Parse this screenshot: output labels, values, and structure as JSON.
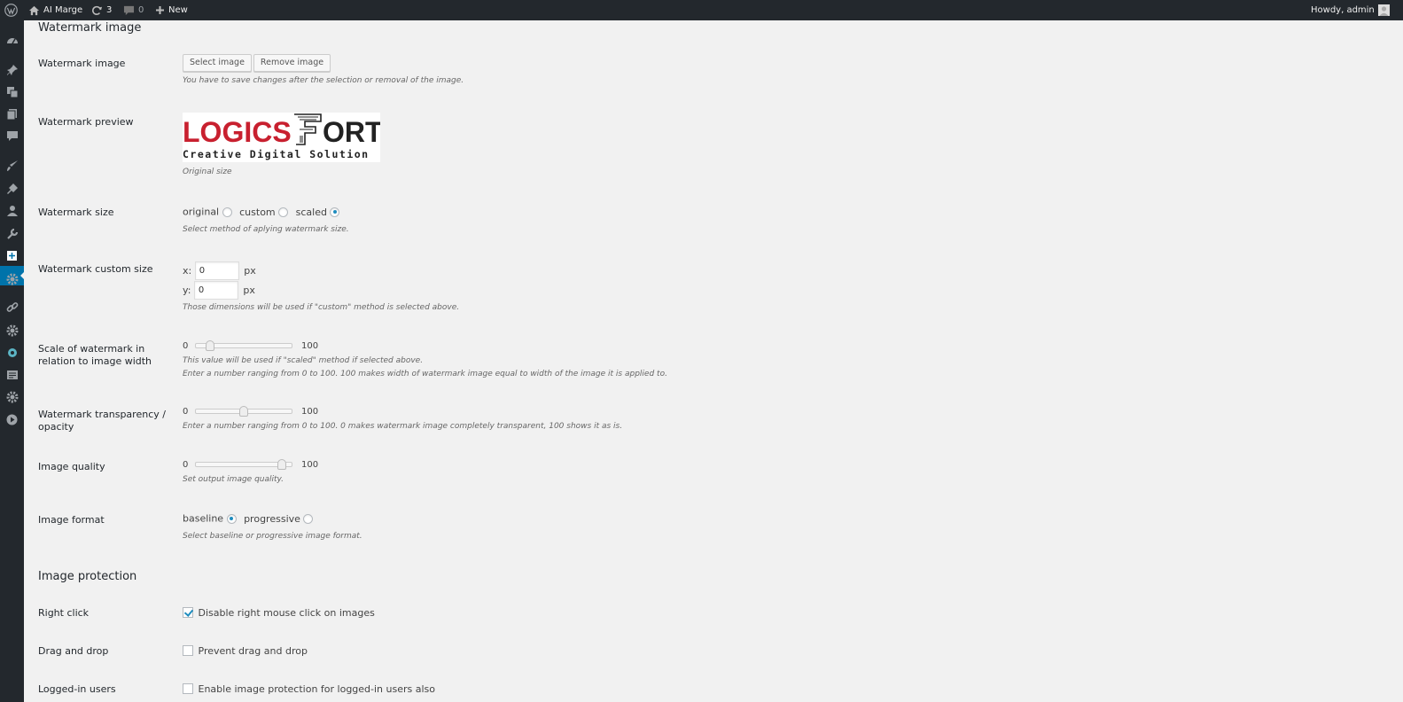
{
  "admin_bar": {
    "site_name": "AI Marge",
    "updates_count": "3",
    "comments_count": "0",
    "new_label": "New",
    "greeting": "Howdy, admin"
  },
  "sidebar": {
    "icons": [
      "dashboard-icon",
      "pin-icon",
      "media-icon",
      "pages-icon",
      "comments-icon",
      "appearance-icon",
      "plugins-icon",
      "users-icon",
      "tools-icon",
      "settings-active-icon",
      "gear-icon",
      "link-icon",
      "gear-icon",
      "circle-icon",
      "forms-icon",
      "gear-icon",
      "play-icon"
    ],
    "active_index": 9
  },
  "watermark_section": {
    "title": "Watermark image",
    "image": {
      "label": "Watermark image",
      "select_button": "Select image",
      "remove_button": "Remove image",
      "description": "You have to save changes after the selection or removal of the image."
    },
    "preview": {
      "label": "Watermark preview",
      "logo_main_left": "LOGICS",
      "logo_main_right": "ORT",
      "logo_tagline": "Creative Digital Solution",
      "description": "Original size"
    },
    "size": {
      "label": "Watermark size",
      "options": [
        "original",
        "custom",
        "scaled"
      ],
      "selected": "scaled",
      "description": "Select method of aplying watermark size."
    },
    "custom_size": {
      "label": "Watermark custom size",
      "x_label": "x:",
      "x_value": "0",
      "y_label": "y:",
      "y_value": "0",
      "unit": "px",
      "description": "Those dimensions will be used if \"custom\" method is selected above."
    },
    "scale": {
      "label": "Scale of watermark in relation to image width",
      "min": "0",
      "max": "100",
      "value": 15,
      "description_1": "This value will be used if \"scaled\" method if selected above.",
      "description_2": "Enter a number ranging from 0 to 100. 100 makes width of watermark image equal to width of the image it is applied to."
    },
    "opacity": {
      "label": "Watermark transparency / opacity",
      "min": "0",
      "max": "100",
      "value": 50,
      "description": "Enter a number ranging from 0 to 100. 0 makes watermark image completely transparent, 100 shows it as is."
    },
    "quality": {
      "label": "Image quality",
      "min": "0",
      "max": "100",
      "value": 90,
      "description": "Set output image quality."
    },
    "format": {
      "label": "Image format",
      "options": [
        "baseline",
        "progressive"
      ],
      "selected": "baseline",
      "description": "Select baseline or progressive image format."
    }
  },
  "protection_section": {
    "title": "Image protection",
    "right_click": {
      "label": "Right click",
      "checkbox_label": "Disable right mouse click on images",
      "checked": true
    },
    "drag_drop": {
      "label": "Drag and drop",
      "checkbox_label": "Prevent drag and drop",
      "checked": false
    },
    "logged_in": {
      "label": "Logged-in users",
      "checkbox_label": "Enable image protection for logged-in users also",
      "checked": false
    }
  },
  "colors": {
    "admin_bar_bg": "#23282d",
    "accent": "#0073aa",
    "page_bg": "#f1f1f1",
    "logo_red": "#c8202f"
  }
}
